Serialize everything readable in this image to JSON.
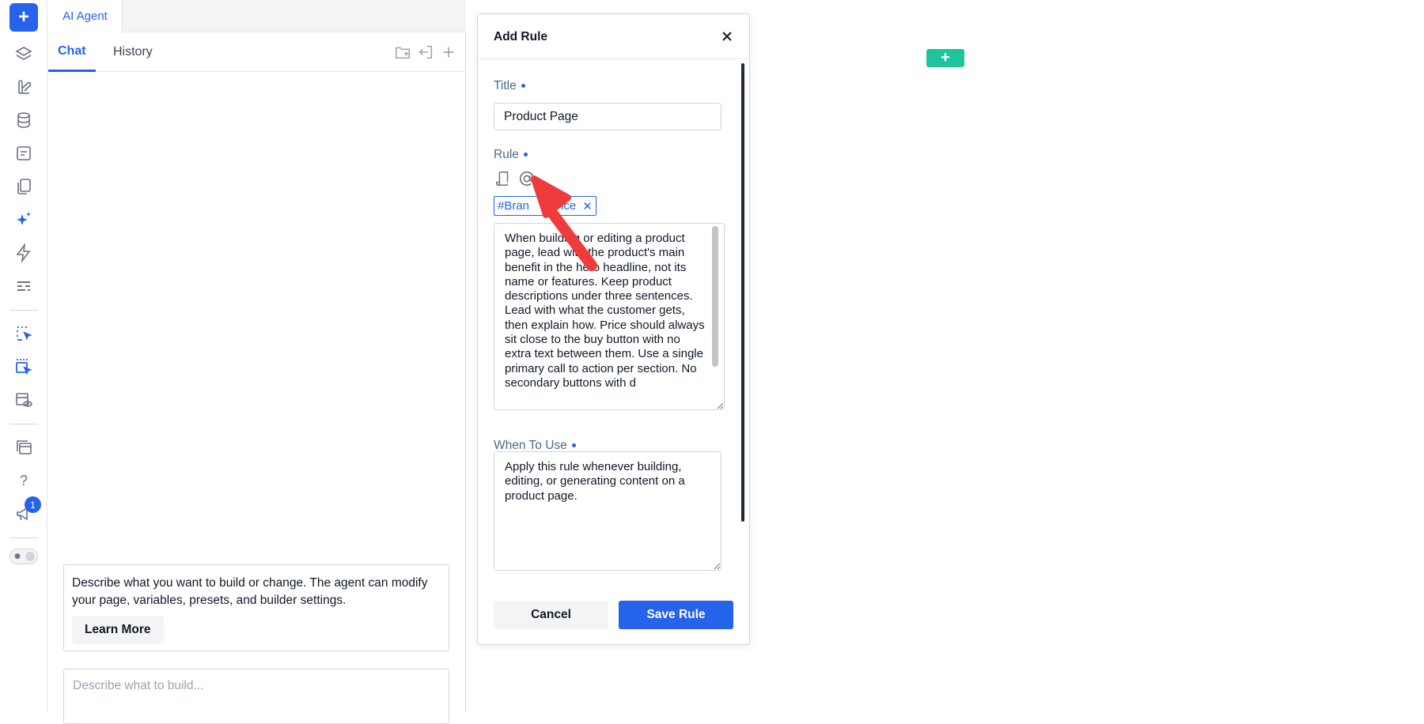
{
  "toolbar": {
    "add_label": "+",
    "icons": [
      "layers-icon",
      "brush-icon",
      "database-icon",
      "form-icon",
      "pages-icon",
      "sparkle-icon",
      "lightning-icon",
      "settings-lines-icon",
      "select-cursor-icon",
      "multi-select-cursor-icon",
      "preview-eye-icon",
      "templates-icon",
      "help-icon",
      "megaphone-icon"
    ],
    "help_label": "?",
    "badge_count": "1"
  },
  "agent": {
    "title": "AI Agent",
    "tabs": [
      {
        "label": "Chat",
        "active": true
      },
      {
        "label": "History",
        "active": false
      }
    ],
    "actions": [
      "new-folder-icon",
      "exit-icon",
      "plus-icon"
    ],
    "info_text": "Describe what you want to build or change. The agent can modify your page, variables, presets, and builder settings.",
    "learn_more": "Learn More",
    "input_placeholder": "Describe what to build..."
  },
  "modal": {
    "title": "Add Rule",
    "title_label": "Title",
    "title_value": "Product Page",
    "rule_label": "Rule",
    "tag": "#BrandVoice",
    "tag_visible": "#Bran",
    "tag_tail": "ice",
    "rule_text": "When building or editing a product page, lead with the product's main benefit in the hero headline, not its name or features. Keep product descriptions under three sentences. Lead with what the customer gets, then explain how. Price should always sit close to the buy button with no extra text between them. Use a single primary call to action per section. No secondary buttons with d",
    "when_label": "When To Use",
    "when_value": "Apply this rule whenever building, editing, or generating content on a product page.",
    "cancel": "Cancel",
    "save": "Save Rule"
  },
  "canvas": {
    "add_label": "+"
  },
  "colors": {
    "accent": "#2563eb",
    "canvas_add": "#1fc59a",
    "annotation_arrow": "#ef3b3b"
  }
}
